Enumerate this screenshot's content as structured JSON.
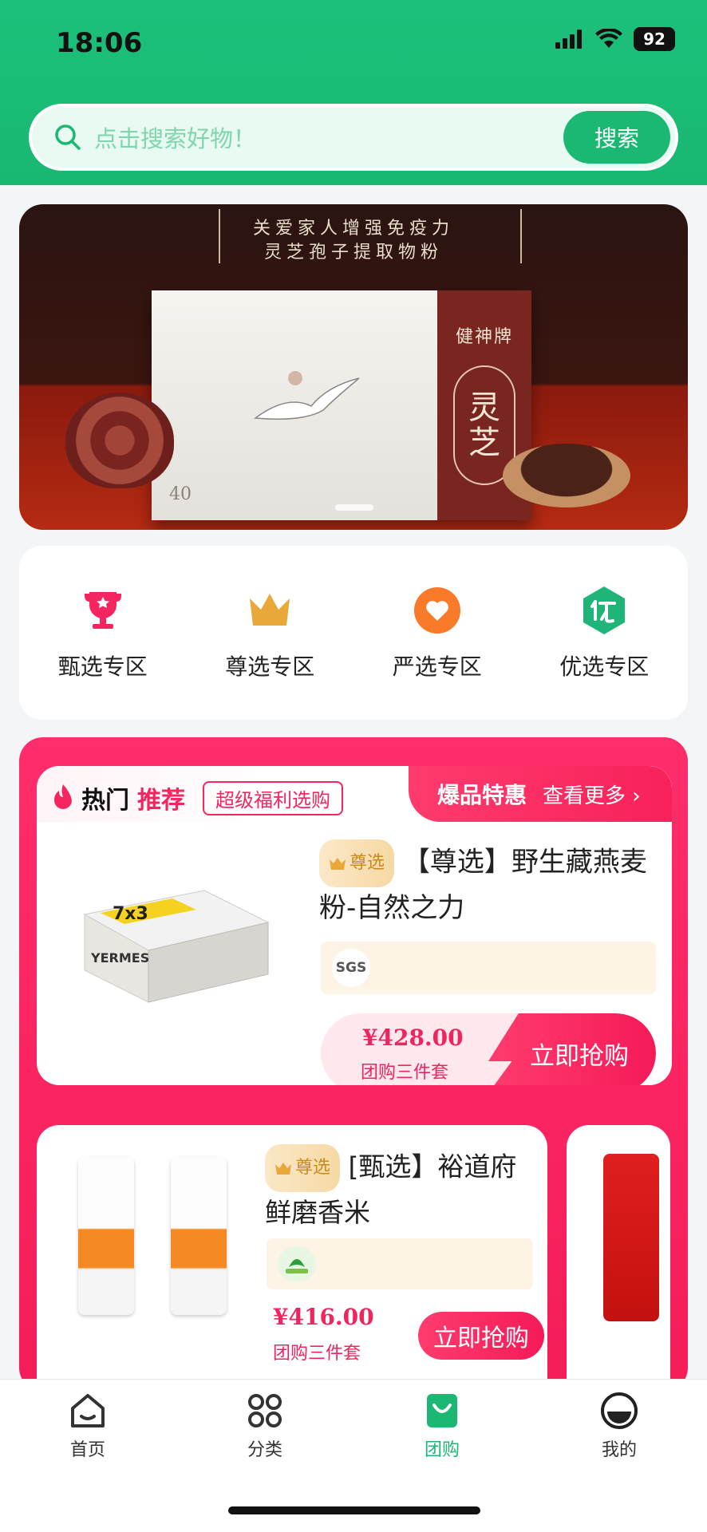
{
  "status": {
    "time": "18:06",
    "battery": "92"
  },
  "search": {
    "placeholder": "点击搜索好物！",
    "button_label": "搜索"
  },
  "banner": {
    "line1": "关爱家人增强免疫力",
    "line2": "灵芝孢子提取物粉",
    "box_brand": "健神牌",
    "box_title_1": "灵",
    "box_title_2": "芝",
    "box_number": "40"
  },
  "categories": [
    {
      "label": "甄选专区",
      "icon": "trophy-icon",
      "color": "#f5265f"
    },
    {
      "label": "尊选专区",
      "icon": "crown-icon",
      "color": "#e9a93a"
    },
    {
      "label": "严选专区",
      "icon": "heart-icon",
      "color": "#f97a28"
    },
    {
      "label": "优选专区",
      "icon": "excellent-icon",
      "color": "#1fb578"
    }
  ],
  "hot": {
    "title_part1": "热门",
    "title_part2": "推荐",
    "tag": "超级福利选购",
    "deals_title": "爆品特惠",
    "see_more": "查看更多 ›"
  },
  "products": [
    {
      "badge": "尊选",
      "title": "【尊选】野生藏燕麦粉-自然之力",
      "cert": "SGS",
      "price": "¥428.00",
      "price_note": "团购三件套",
      "buy_label": "立即抢购"
    },
    {
      "badge": "尊选",
      "title": "[甄选】裕道府鲜磨香米",
      "price": "¥416.00",
      "price_note": "团购三件套",
      "buy_label": "立即抢购"
    }
  ],
  "tabs": [
    {
      "label": "首页",
      "icon": "home-icon"
    },
    {
      "label": "分类",
      "icon": "category-icon"
    },
    {
      "label": "团购",
      "icon": "group-buy-icon",
      "active": true
    },
    {
      "label": "我的",
      "icon": "profile-icon"
    }
  ],
  "colors": {
    "brand_green": "#1bb873",
    "hot_pink": "#f5265f"
  }
}
